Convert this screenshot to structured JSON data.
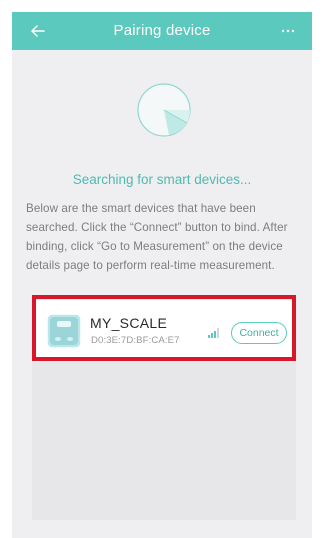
{
  "header": {
    "title": "Pairing device",
    "back_icon": "back-arrow-icon",
    "more_icon": "more-dots-icon",
    "color": "#5cc9be"
  },
  "search": {
    "status_text": "Searching for smart devices...",
    "description": "Below are the smart devices that have been searched. Click the “Connect” button to bind. After binding, click “Go to Measurement” on the device details page to perform real-time measurement."
  },
  "devices": [
    {
      "name": "MY_SCALE",
      "mac": "D0:3E:7D:BF:CA:E7",
      "connect_label": "Connect",
      "icon": "scale-icon",
      "signal_icon": "signal-icon"
    }
  ],
  "colors": {
    "accent": "#5cc9be",
    "highlight": "#d7182a",
    "background": "#efeff1"
  }
}
